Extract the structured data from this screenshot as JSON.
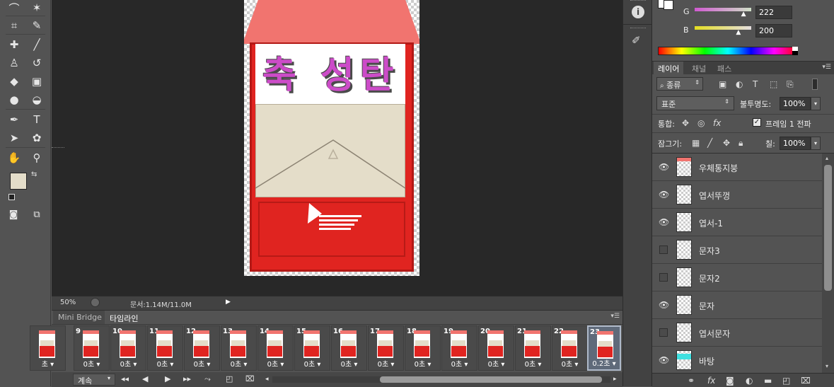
{
  "tools": {
    "icons": [
      "lasso-icon",
      "magic-wand-icon",
      "crop-icon",
      "eyedropper-icon",
      "spot-healing-icon",
      "brush-icon",
      "stamp-icon",
      "history-brush-icon",
      "eraser-icon",
      "gradient-icon",
      "blur-icon",
      "dodge-icon",
      "pen-icon",
      "type-icon",
      "path-select-icon",
      "shape-icon",
      "hand-icon",
      "zoom-icon",
      "quick-mask-icon",
      "screen-mode-icon"
    ],
    "foreground_color": "#e4ddc9",
    "background_color": "#ffffff"
  },
  "canvas": {
    "banner_text": "축 성탄",
    "banner_color": "#cc4cc8",
    "roof_color": "#f1746f",
    "body_color": "#e02420",
    "envelope_color": "#e4ddc9"
  },
  "status": {
    "zoom": "50%",
    "doc_info": "문서:1.14M/11.0M"
  },
  "timeline": {
    "tabs": [
      "Mini Bridge",
      "타임라인"
    ],
    "active_tab": "타임라인",
    "frames": [
      {
        "num": "",
        "delay": "초"
      },
      {
        "num": "9",
        "delay": "0초"
      },
      {
        "num": "10",
        "delay": "0초"
      },
      {
        "num": "11",
        "delay": "0초"
      },
      {
        "num": "12",
        "delay": "0초"
      },
      {
        "num": "13",
        "delay": "0초"
      },
      {
        "num": "14",
        "delay": "0초"
      },
      {
        "num": "15",
        "delay": "0초"
      },
      {
        "num": "16",
        "delay": "0초"
      },
      {
        "num": "17",
        "delay": "0초"
      },
      {
        "num": "18",
        "delay": "0초"
      },
      {
        "num": "19",
        "delay": "0초"
      },
      {
        "num": "20",
        "delay": "0초"
      },
      {
        "num": "21",
        "delay": "0초"
      },
      {
        "num": "22",
        "delay": "0초"
      },
      {
        "num": "23",
        "delay": "0.2초"
      }
    ],
    "loop_label": "계속",
    "controls": [
      "first-frame-icon",
      "prev-frame-icon",
      "play-icon",
      "next-frame-icon",
      "tween-icon",
      "duplicate-frame-icon",
      "delete-frame-icon"
    ]
  },
  "color_panel": {
    "g_label": "G",
    "g_value": "222",
    "g_fraction": 0.87,
    "b_label": "B",
    "b_value": "200",
    "b_fraction": 0.78
  },
  "layers_panel": {
    "tabs": [
      "레이어",
      "채널",
      "패스"
    ],
    "filter_label": "종류",
    "blend_mode": "표준",
    "opacity_label": "불투명도:",
    "opacity_value": "100%",
    "unify_label": "통합:",
    "propagate_label": "프레임 1 전파",
    "lock_label": "잠그기:",
    "fill_label": "칠:",
    "fill_value": "100%",
    "layers": [
      {
        "name": "우체통지붕",
        "visible": true
      },
      {
        "name": "엽서뚜껑",
        "visible": true
      },
      {
        "name": "엽서-1",
        "visible": true
      },
      {
        "name": "문자3",
        "visible": false
      },
      {
        "name": "문자2",
        "visible": false
      },
      {
        "name": "문자",
        "visible": true
      },
      {
        "name": "엽서문자",
        "visible": false
      },
      {
        "name": "바탕",
        "visible": true
      }
    ]
  }
}
